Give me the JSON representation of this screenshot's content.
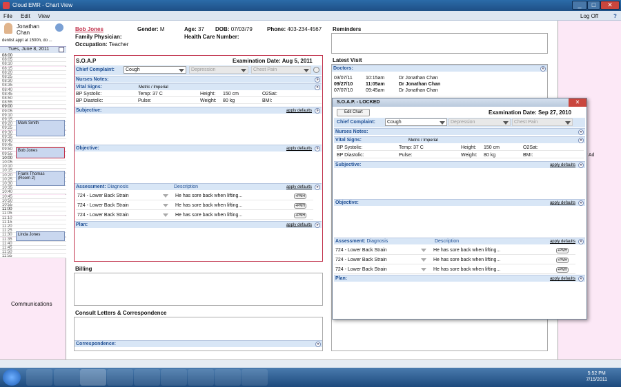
{
  "window": {
    "title": "Cloud EMR - Chart View",
    "logoff": "Log Off",
    "help": "?",
    "minimize": "_",
    "restore": "□",
    "close": "✕"
  },
  "menu": [
    "File",
    "Edit",
    "View"
  ],
  "user": {
    "first": "Jonathan",
    "last": "Chan",
    "reminder": "dentist appt at 1500h, do ...",
    "date": "Tues, June 8, 2011"
  },
  "schedule": {
    "slots": [
      "08:00",
      "08:05",
      "08:10",
      "08:15",
      "08:20",
      "08:25",
      "08:30",
      "08:35",
      "08:40",
      "08:45",
      "08:50",
      "08:55",
      "09:00",
      "09:05",
      "09:10",
      "09:15",
      "09:20",
      "09:25",
      "09:30",
      "09:35",
      "09:40",
      "09:45",
      "09:50",
      "09:55",
      "10:00",
      "10:05",
      "10:10",
      "10:15",
      "10:20",
      "10:25",
      "10:30",
      "10:35",
      "10:40",
      "10:45",
      "10:50",
      "10:55",
      "11:00",
      "11:05",
      "11:10",
      "11:15",
      "11:20",
      "11:25",
      "11:30",
      "11:35",
      "11:40",
      "11:45",
      "11:50",
      "11:55"
    ],
    "appointments": [
      "Mark Smith",
      "Bob Jones",
      "Frank Thomas",
      "(Room 2)",
      "Linda Jones"
    ]
  },
  "communications": "Communications",
  "patient": {
    "name": "Bob Jones",
    "gender_label": "Gender:",
    "gender": "M",
    "age_label": "Age:",
    "age": "37",
    "dob_label": "DOB:",
    "dob": "07/03/79",
    "phone_label": "Phone:",
    "phone": "403-234-4567",
    "family_physician": "Family Physician:",
    "occupation_label": "Occupation:",
    "occupation": "Teacher",
    "health_care_number": "Health Care Number:"
  },
  "soap": {
    "title": "S.O.A.P",
    "exam_label": "Examination Date:",
    "exam_date": "Aug 5, 2011",
    "chief_complaint": "Chief Complaint:",
    "complaint1": "Cough",
    "complaint2": "Depression",
    "complaint3": "Chest Pain",
    "nurses_notes": "Nurses Notes:",
    "vital_signs": "Vital Signs:",
    "metric": "Metric / Imperial",
    "bp_systolic": "BP Systolic:",
    "temp": "Temp: 37 C",
    "height": "Height:",
    "height_val": "150 cm",
    "o2sat": "O2Sat:",
    "bp_diastolic": "BP Diastolic:",
    "pulse": "Pulse:",
    "weight": "Weight:",
    "weight_val": "80 kg",
    "bmi": "BMI:",
    "subjective": "Subjective:",
    "objective": "Objective:",
    "assessment": "Assessment:",
    "diagnosis": "Diagnosis",
    "description": "Description",
    "plan": "Plan:",
    "apply_defaults": "apply defaults",
    "pmh": "+PMH",
    "diag_rows": [
      {
        "code": "724 - Lower Back Strain",
        "desc": "He has sore back when lifting..."
      },
      {
        "code": "724 - Lower Back Strain",
        "desc": "He has sore back when lifting..."
      },
      {
        "code": "724 - Lower Back Strain",
        "desc": "He has sore back when lifting..."
      }
    ]
  },
  "billing": "Billing",
  "consult": "Consult Letters & Correspondence",
  "correspondence": "Correspondence:",
  "reminders": "Reminders",
  "latest_visit": "Latest Visit",
  "doctors": {
    "label": "Doctors:",
    "visits": [
      {
        "date": "03/07/11",
        "time": "10:15am",
        "doctor": "Dr Jonathan Chan",
        "bold": false
      },
      {
        "date": "09/27/10",
        "time": "11:05am",
        "doctor": "Dr Jonathan Chan",
        "bold": true
      },
      {
        "date": "07/07/10",
        "time": "09:45am",
        "doctor": "Dr Jonathan Chan",
        "bold": false
      }
    ]
  },
  "right_ad": "r Ad",
  "locked": {
    "title": "S.O.A.P. - LOCKED",
    "edit_chart": "Edit Chart",
    "exam_label": "Examination Date:",
    "exam_date": "Sep 27, 2010",
    "close": "✕"
  },
  "taskbar": {
    "time": "5:52 PM",
    "date": "7/15/2011"
  },
  "colors": {
    "accent": "#1f4f94",
    "soap_border": "#c0304a",
    "pink": "#fce8f6"
  }
}
